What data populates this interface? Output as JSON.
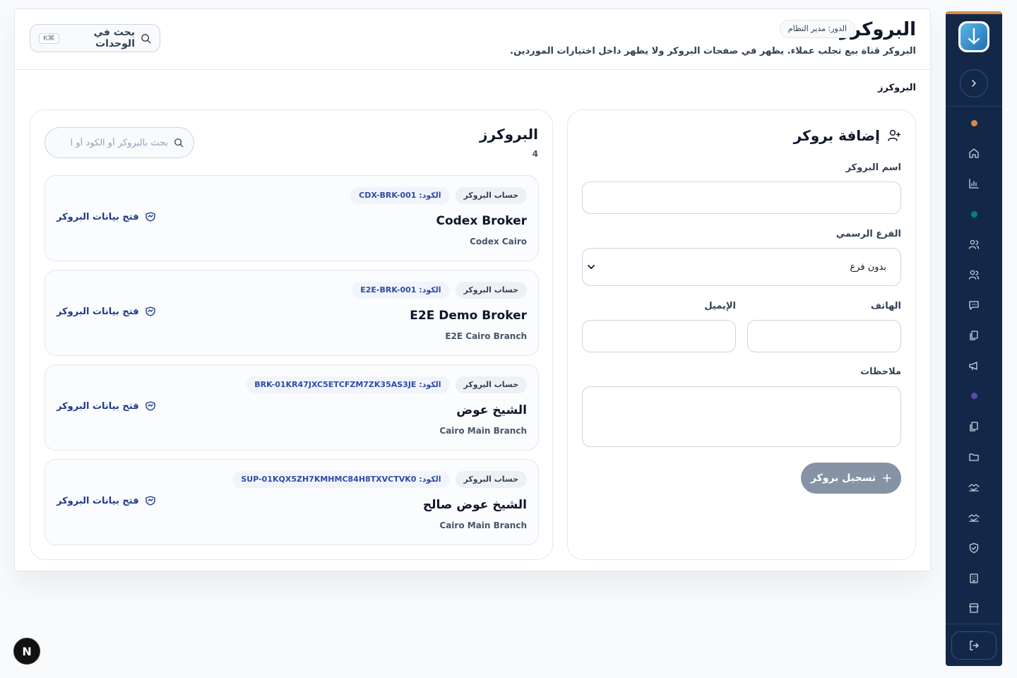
{
  "header": {
    "title": "البروكرز",
    "role_badge": "الدور: مدير النظام",
    "subtitle": "البروكر قناة بيع تجلب عملاء. يظهر في صفحات البروكر ولا يظهر داخل اختيارات الموردين.",
    "search_label": "بحث في الوحدات",
    "search_shortcut": "K⌘"
  },
  "breadcrumb": "البروكرز",
  "form": {
    "title": "إضافة بروكر",
    "name_label": "اسم البروكر",
    "branch_label": "الفرع الرسمي",
    "branch_value": "بدون فرع",
    "phone_label": "الهاتف",
    "email_label": "الإيميل",
    "notes_label": "ملاحظات",
    "submit_label": "تسجيل بروكر",
    "submit_icon": "plus-icon"
  },
  "list": {
    "title": "البروكرز",
    "count": "4",
    "search_placeholder": "بحث بالبروكر أو الكود أو ا",
    "link_label": "فتح بيانات البروكر",
    "items": [
      {
        "account_badge": "حساب البروكر",
        "code_label": "الكود:",
        "code": "CDX-BRK-001",
        "name": "Codex Broker",
        "branch": "Codex Cairo"
      },
      {
        "account_badge": "حساب البروكر",
        "code_label": "الكود:",
        "code": "E2E-BRK-001",
        "name": "E2E Demo Broker",
        "branch": "E2E Cairo Branch"
      },
      {
        "account_badge": "حساب البروكر",
        "code_label": "الكود:",
        "code": "BRK-01KR47JXC5ETCFZM7ZK35AS3JE",
        "name": "الشيخ عوض",
        "branch": "Cairo Main Branch"
      },
      {
        "account_badge": "حساب البروكر",
        "code_label": "الكود:",
        "code": "SUP-01KQX5ZH7KMHMC84H8TXVCTVK0",
        "name": "الشيخ عوض صالح",
        "branch": "Cairo Main Branch"
      }
    ]
  },
  "sidebar": {
    "items": [
      "dot-orange",
      "home-icon",
      "chart-icon",
      "dot-teal",
      "users-icon",
      "users-icon",
      "chat-icon",
      "documents-icon",
      "megaphone-icon",
      "dot-purple",
      "documents-icon",
      "folder-icon",
      "handshake-icon",
      "handshake-icon",
      "shield-icon",
      "building-icon",
      "store-icon"
    ]
  },
  "colors": {
    "sidebar_bg": "#132848",
    "accent_orange": "#d98b4a",
    "dot_teal": "#0e7c7b",
    "dot_purple": "#5b4bb0",
    "link_blue": "#1e3a8a",
    "button_disabled": "#8593a5"
  },
  "dev_badge": "N"
}
